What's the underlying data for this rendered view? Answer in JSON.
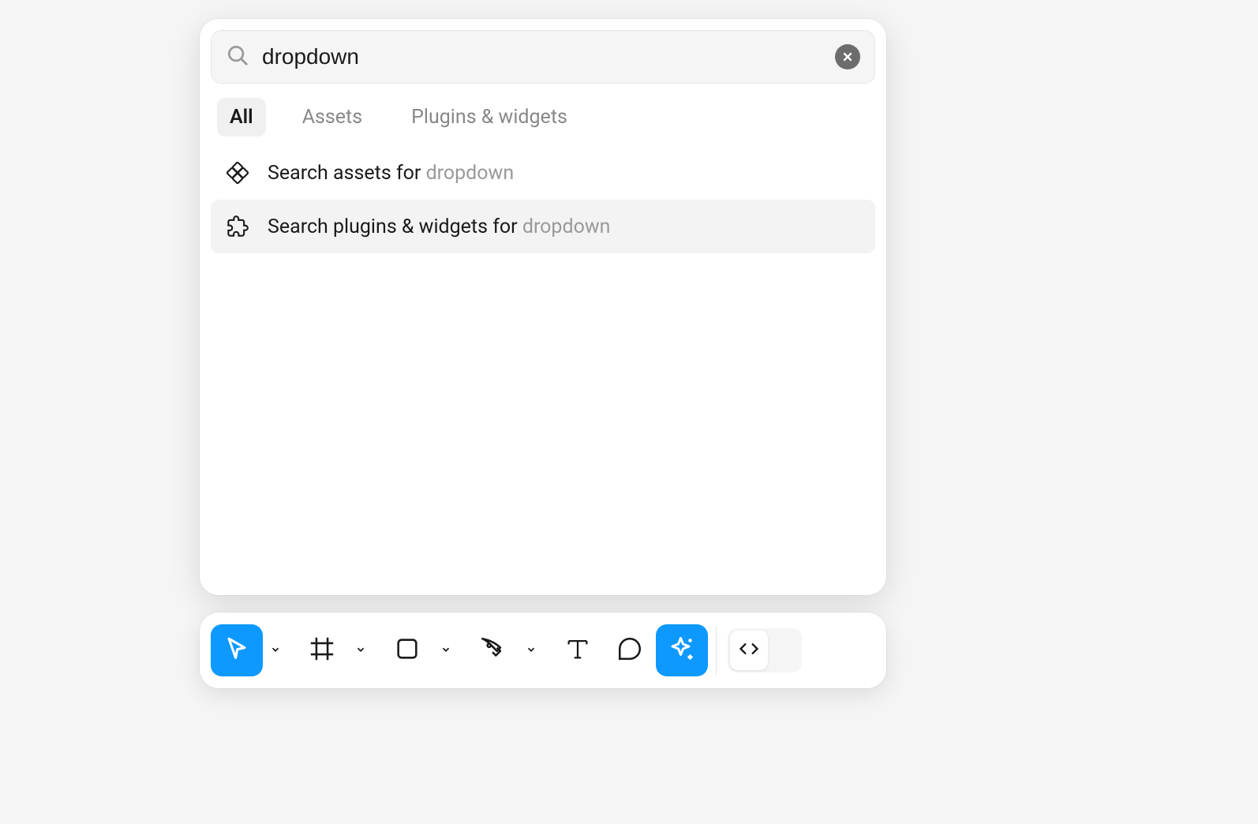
{
  "search": {
    "value": "dropdown",
    "placeholder": "Search"
  },
  "tabs": {
    "all": "All",
    "assets": "Assets",
    "plugins": "Plugins & widgets"
  },
  "results": {
    "assets_prefix": "Search assets for ",
    "assets_query": "dropdown",
    "plugins_prefix": "Search plugins & widgets for ",
    "plugins_query": "dropdown"
  },
  "toolbar": {
    "move": "Move",
    "frame": "Frame",
    "shape": "Rectangle",
    "pen": "Pen",
    "text": "Text",
    "comment": "Comment",
    "actions": "Actions",
    "devmode": "Dev Mode"
  }
}
